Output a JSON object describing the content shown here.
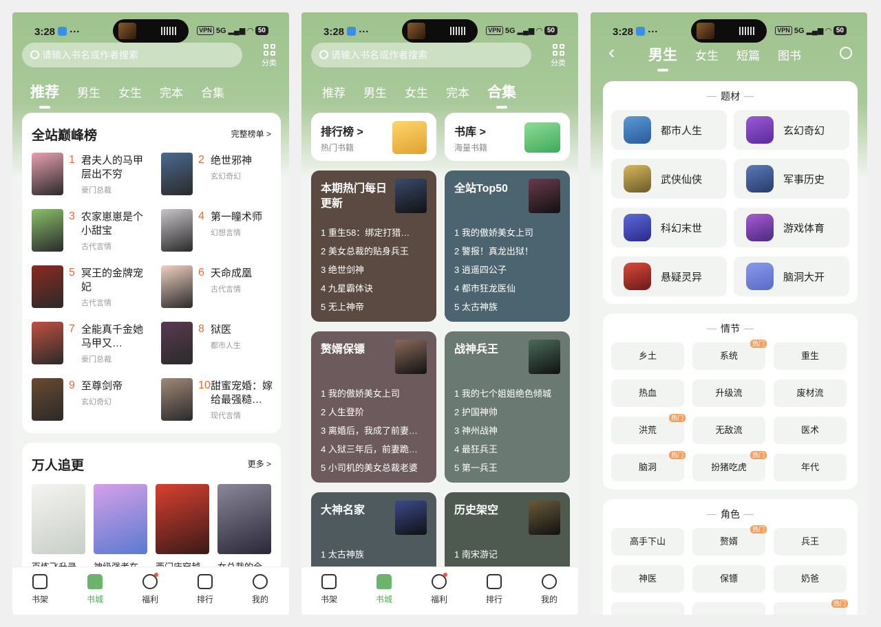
{
  "status": {
    "time": "3:28",
    "vpn": "VPN",
    "net": "5G",
    "battery": "50"
  },
  "search": {
    "placeholder": "请输入书名或作者搜索"
  },
  "category_label": "分类",
  "tabs": [
    "推荐",
    "男生",
    "女生",
    "完本",
    "合集"
  ],
  "p1": {
    "ranking": {
      "title": "全站巅峰榜",
      "more": "完整榜单 >",
      "items": [
        {
          "n": "1",
          "title": "君夫人的马甲层出不穷",
          "tag": "豪门总裁"
        },
        {
          "n": "2",
          "title": "绝世邪神",
          "tag": "玄幻奇幻"
        },
        {
          "n": "3",
          "title": "农家崽崽是个小甜宝",
          "tag": "古代言情"
        },
        {
          "n": "4",
          "title": "第一瞳术师",
          "tag": "幻想言情"
        },
        {
          "n": "5",
          "title": "冥王的金牌宠妃",
          "tag": "古代言情"
        },
        {
          "n": "6",
          "title": "天命成凰",
          "tag": "古代言情"
        },
        {
          "n": "7",
          "title": "全能真千金她马甲又…",
          "tag": "豪门总裁"
        },
        {
          "n": "8",
          "title": "狱医",
          "tag": "都市人生"
        },
        {
          "n": "9",
          "title": "至尊剑帝",
          "tag": "玄幻奇幻"
        },
        {
          "n": "10",
          "title": "甜蜜宠婚：嫁给最强糙…",
          "tag": "现代言情"
        }
      ]
    },
    "follow": {
      "title": "万人追更",
      "more": "更多 >",
      "books": [
        "百炼飞升录",
        "神级强者在…",
        "西门庆穿越…",
        "女总裁的全…"
      ]
    }
  },
  "nav": [
    "书架",
    "书城",
    "福利",
    "排行",
    "我的"
  ],
  "p2": {
    "top_cards": [
      {
        "title": "排行榜 >",
        "sub": "热门书籍"
      },
      {
        "title": "书库 >",
        "sub": "海量书籍"
      }
    ],
    "lists": [
      {
        "title": "本期热门每日更新",
        "color": "#5a4a42",
        "rows": [
          "1 重生58：绑定打猎…",
          "2 美女总裁的贴身兵王",
          "3 绝世剑神",
          "4 九星霸体诀",
          "5 无上神帝"
        ]
      },
      {
        "title": "全站Top50",
        "color": "#4c6470",
        "rows": [
          "1 我的傲娇美女上司",
          "2 警报！真龙出狱！",
          "3 逍遥四公子",
          "4 都市狂龙医仙",
          "5 太古神族"
        ]
      },
      {
        "title": "赘婿保镖",
        "color": "#6d5a5c",
        "rows": [
          "1 我的傲娇美女上司",
          "2 人生登阶",
          "3 离婚后，我成了前妻…",
          "4 入狱三年后，前妻跪…",
          "5 小司机的美女总裁老婆"
        ]
      },
      {
        "title": "战神兵王",
        "color": "#6a7a72",
        "rows": [
          "1 我的七个姐姐绝色倾城",
          "2 护国神帅",
          "3 神州战神",
          "4 最狂兵王",
          "5 第一兵王"
        ]
      },
      {
        "title": "大神名家",
        "color": "#4f5a5f",
        "rows": [
          "1 太古神族"
        ]
      },
      {
        "title": "历史架空",
        "color": "#4e5a50",
        "rows": [
          "1 南宋游记"
        ]
      }
    ]
  },
  "p3": {
    "tabs": [
      "男生",
      "女生",
      "短篇",
      "图书"
    ],
    "theme_label": "题材",
    "genres": [
      "都市人生",
      "玄幻奇幻",
      "武侠仙侠",
      "军事历史",
      "科幻末世",
      "游戏体育",
      "悬疑灵异",
      "脑洞大开"
    ],
    "plot_label": "情节",
    "plots": [
      {
        "t": "乡土"
      },
      {
        "t": "系统",
        "hot": "热门"
      },
      {
        "t": "重生"
      },
      {
        "t": "热血"
      },
      {
        "t": "升级流"
      },
      {
        "t": "废材流"
      },
      {
        "t": "洪荒",
        "hot": "热门"
      },
      {
        "t": "无敌流"
      },
      {
        "t": "医术"
      },
      {
        "t": "脑洞",
        "hot": "热门"
      },
      {
        "t": "扮猪吃虎",
        "hot": "热门"
      },
      {
        "t": "年代"
      }
    ],
    "role_label": "角色",
    "roles": [
      {
        "t": "高手下山"
      },
      {
        "t": "赘婿",
        "hot": "热门"
      },
      {
        "t": "兵王"
      },
      {
        "t": "神医"
      },
      {
        "t": "保镖"
      },
      {
        "t": "奶爸"
      }
    ],
    "partial_hot": "热门"
  },
  "colors": {
    "accent": "#5aa25a",
    "rank_num": "#e06e3a",
    "hot_badge": "#f0a062",
    "header_green": "#a9c99a"
  }
}
